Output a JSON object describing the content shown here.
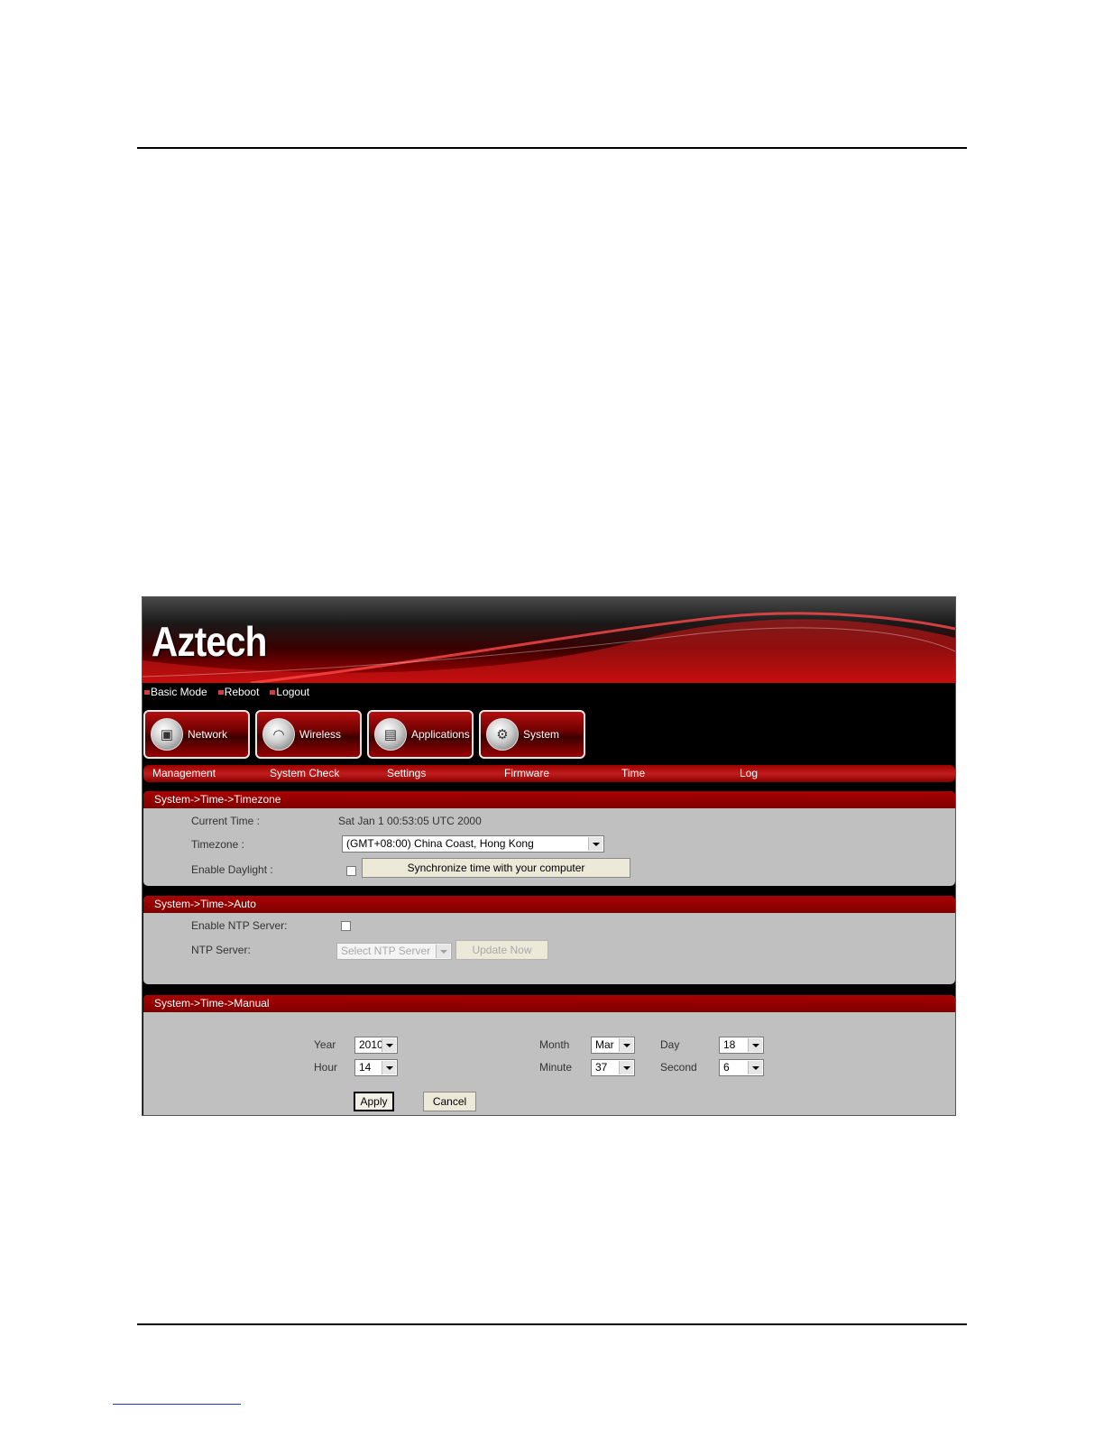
{
  "brand": {
    "logo": "Aztech"
  },
  "top_links": [
    {
      "label": "Basic Mode"
    },
    {
      "label": "Reboot"
    },
    {
      "label": "Logout"
    }
  ],
  "main_nav": [
    {
      "label": "Network",
      "icon": "network-icon"
    },
    {
      "label": "Wireless",
      "icon": "wireless-icon"
    },
    {
      "label": "Applications",
      "icon": "applications-icon"
    },
    {
      "label": "System",
      "icon": "system-icon"
    }
  ],
  "sub_nav": [
    {
      "label": "Management"
    },
    {
      "label": "System Check"
    },
    {
      "label": "Settings"
    },
    {
      "label": "Firmware"
    },
    {
      "label": "Time"
    },
    {
      "label": "Log"
    }
  ],
  "timezone_section": {
    "title": "System->Time->Timezone",
    "current_time_label": "Current Time :",
    "current_time_value": "Sat Jan 1 00:53:05 UTC 2000",
    "timezone_label": "Timezone :",
    "timezone_value": "(GMT+08:00) China Coast, Hong Kong",
    "daylight_label": "Enable Daylight :",
    "daylight_checked": false,
    "sync_button": "Synchronize time with your computer"
  },
  "auto_section": {
    "title": "System->Time->Auto",
    "ntp_enable_label": "Enable NTP Server:",
    "ntp_enable_checked": false,
    "ntp_server_label": "NTP Server:",
    "ntp_server_value": "Select NTP Server",
    "update_button": "Update Now"
  },
  "manual_section": {
    "title": "System->Time->Manual",
    "year_label": "Year",
    "year_value": "2010",
    "month_label": "Month",
    "month_value": "Mar",
    "day_label": "Day",
    "day_value": "18",
    "hour_label": "Hour",
    "hour_value": "14",
    "minute_label": "Minute",
    "minute_value": "37",
    "second_label": "Second",
    "second_value": "6",
    "apply_button": "Apply",
    "cancel_button": "Cancel"
  },
  "colors": {
    "header_red": "#a80000",
    "panel_gray": "#c0c0c0"
  }
}
